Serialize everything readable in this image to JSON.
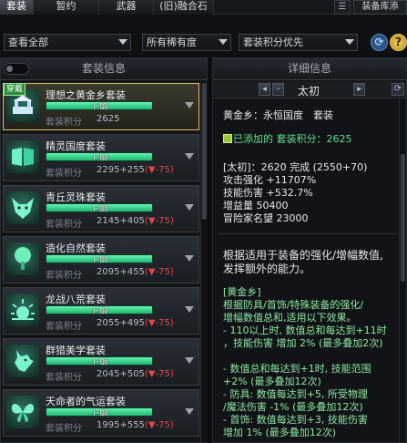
{
  "tabs": {
    "items": [
      "套装",
      "暂约",
      "武器",
      "(旧)融合石"
    ],
    "active_index": 0,
    "right_label": "装备库添"
  },
  "filters": {
    "view": "查看全部",
    "rarity": "所有稀有度",
    "sort": "套装积分优先"
  },
  "left_panel": {
    "title": "套装信息",
    "equipped_badge": "穿戴",
    "items": [
      {
        "name": "理想之黄金乡套装",
        "bar_text": "上限",
        "fill": 1.0,
        "score_label": "套装积分",
        "score": "2625",
        "penalty": "",
        "icon": "temple-icon",
        "selected": true
      },
      {
        "name": "精灵国度套装",
        "bar_text": "上限",
        "fill": 1.0,
        "score_label": "套装积分",
        "score": "2295+255",
        "penalty": "(▼-75)",
        "icon": "book-icon",
        "selected": false
      },
      {
        "name": "青丘灵珠套装",
        "bar_text": "上限",
        "fill": 1.0,
        "score_label": "套装积分",
        "score": "2145+405",
        "penalty": "(▼-75)",
        "icon": "fox-icon",
        "selected": false
      },
      {
        "name": "造化自然套装",
        "bar_text": "上限",
        "fill": 1.0,
        "score_label": "套装积分",
        "score": "2095+455",
        "penalty": "(▼-75)",
        "icon": "tree-icon",
        "selected": false
      },
      {
        "name": "龙战八荒套装",
        "bar_text": "上限",
        "fill": 1.0,
        "score_label": "套装积分",
        "score": "2055+495",
        "penalty": "(▼-75)",
        "icon": "sun-icon",
        "selected": false
      },
      {
        "name": "群猎美学套装",
        "bar_text": "上限",
        "fill": 1.0,
        "score_label": "套装积分",
        "score": "2045+505",
        "penalty": "(▼-75)",
        "icon": "wolf-icon",
        "selected": false
      },
      {
        "name": "天命者的气运套装",
        "bar_text": "上限",
        "fill": 1.0,
        "score_label": "套装积分",
        "score": "1995+555",
        "penalty": "(▼-75)",
        "icon": "butterfly-icon",
        "selected": false
      }
    ]
  },
  "right_panel": {
    "title": "详细信息",
    "nav_title": "太初",
    "set_title": "黄金乡：永恒国度　套装",
    "added_label": "已添加的 套装积分：2625",
    "stats": [
      "[太初]：2620 完成 (2550+70)",
      "攻击强化 +11707%",
      "技能伤害 +532.7%",
      "增益量 50400",
      "冒险家名望 23000"
    ],
    "desc": [
      "根据适用于装备的强化/增幅数值,",
      "发挥额外的能力。"
    ],
    "effect_title": "[黄金乡]",
    "effects": [
      "根据防具/首饰/特殊装备的强化/",
      "增幅数值总和,适用以下效果。",
      "- 110以上时, 数值总和每达到+11时",
      "，技能伤害 增加 2% (最多叠加2次)",
      "",
      "- 数值总和每达到+1时, 技能范围",
      "+2% (最多叠加12次)",
      "- 防具: 数值每达到+5, 所受物理",
      "/魔法伤害 -1% (最多叠加12次)",
      "- 首饰: 数值每达到+3, 技能伤害",
      "增加 1% (最多叠加12次)"
    ]
  }
}
